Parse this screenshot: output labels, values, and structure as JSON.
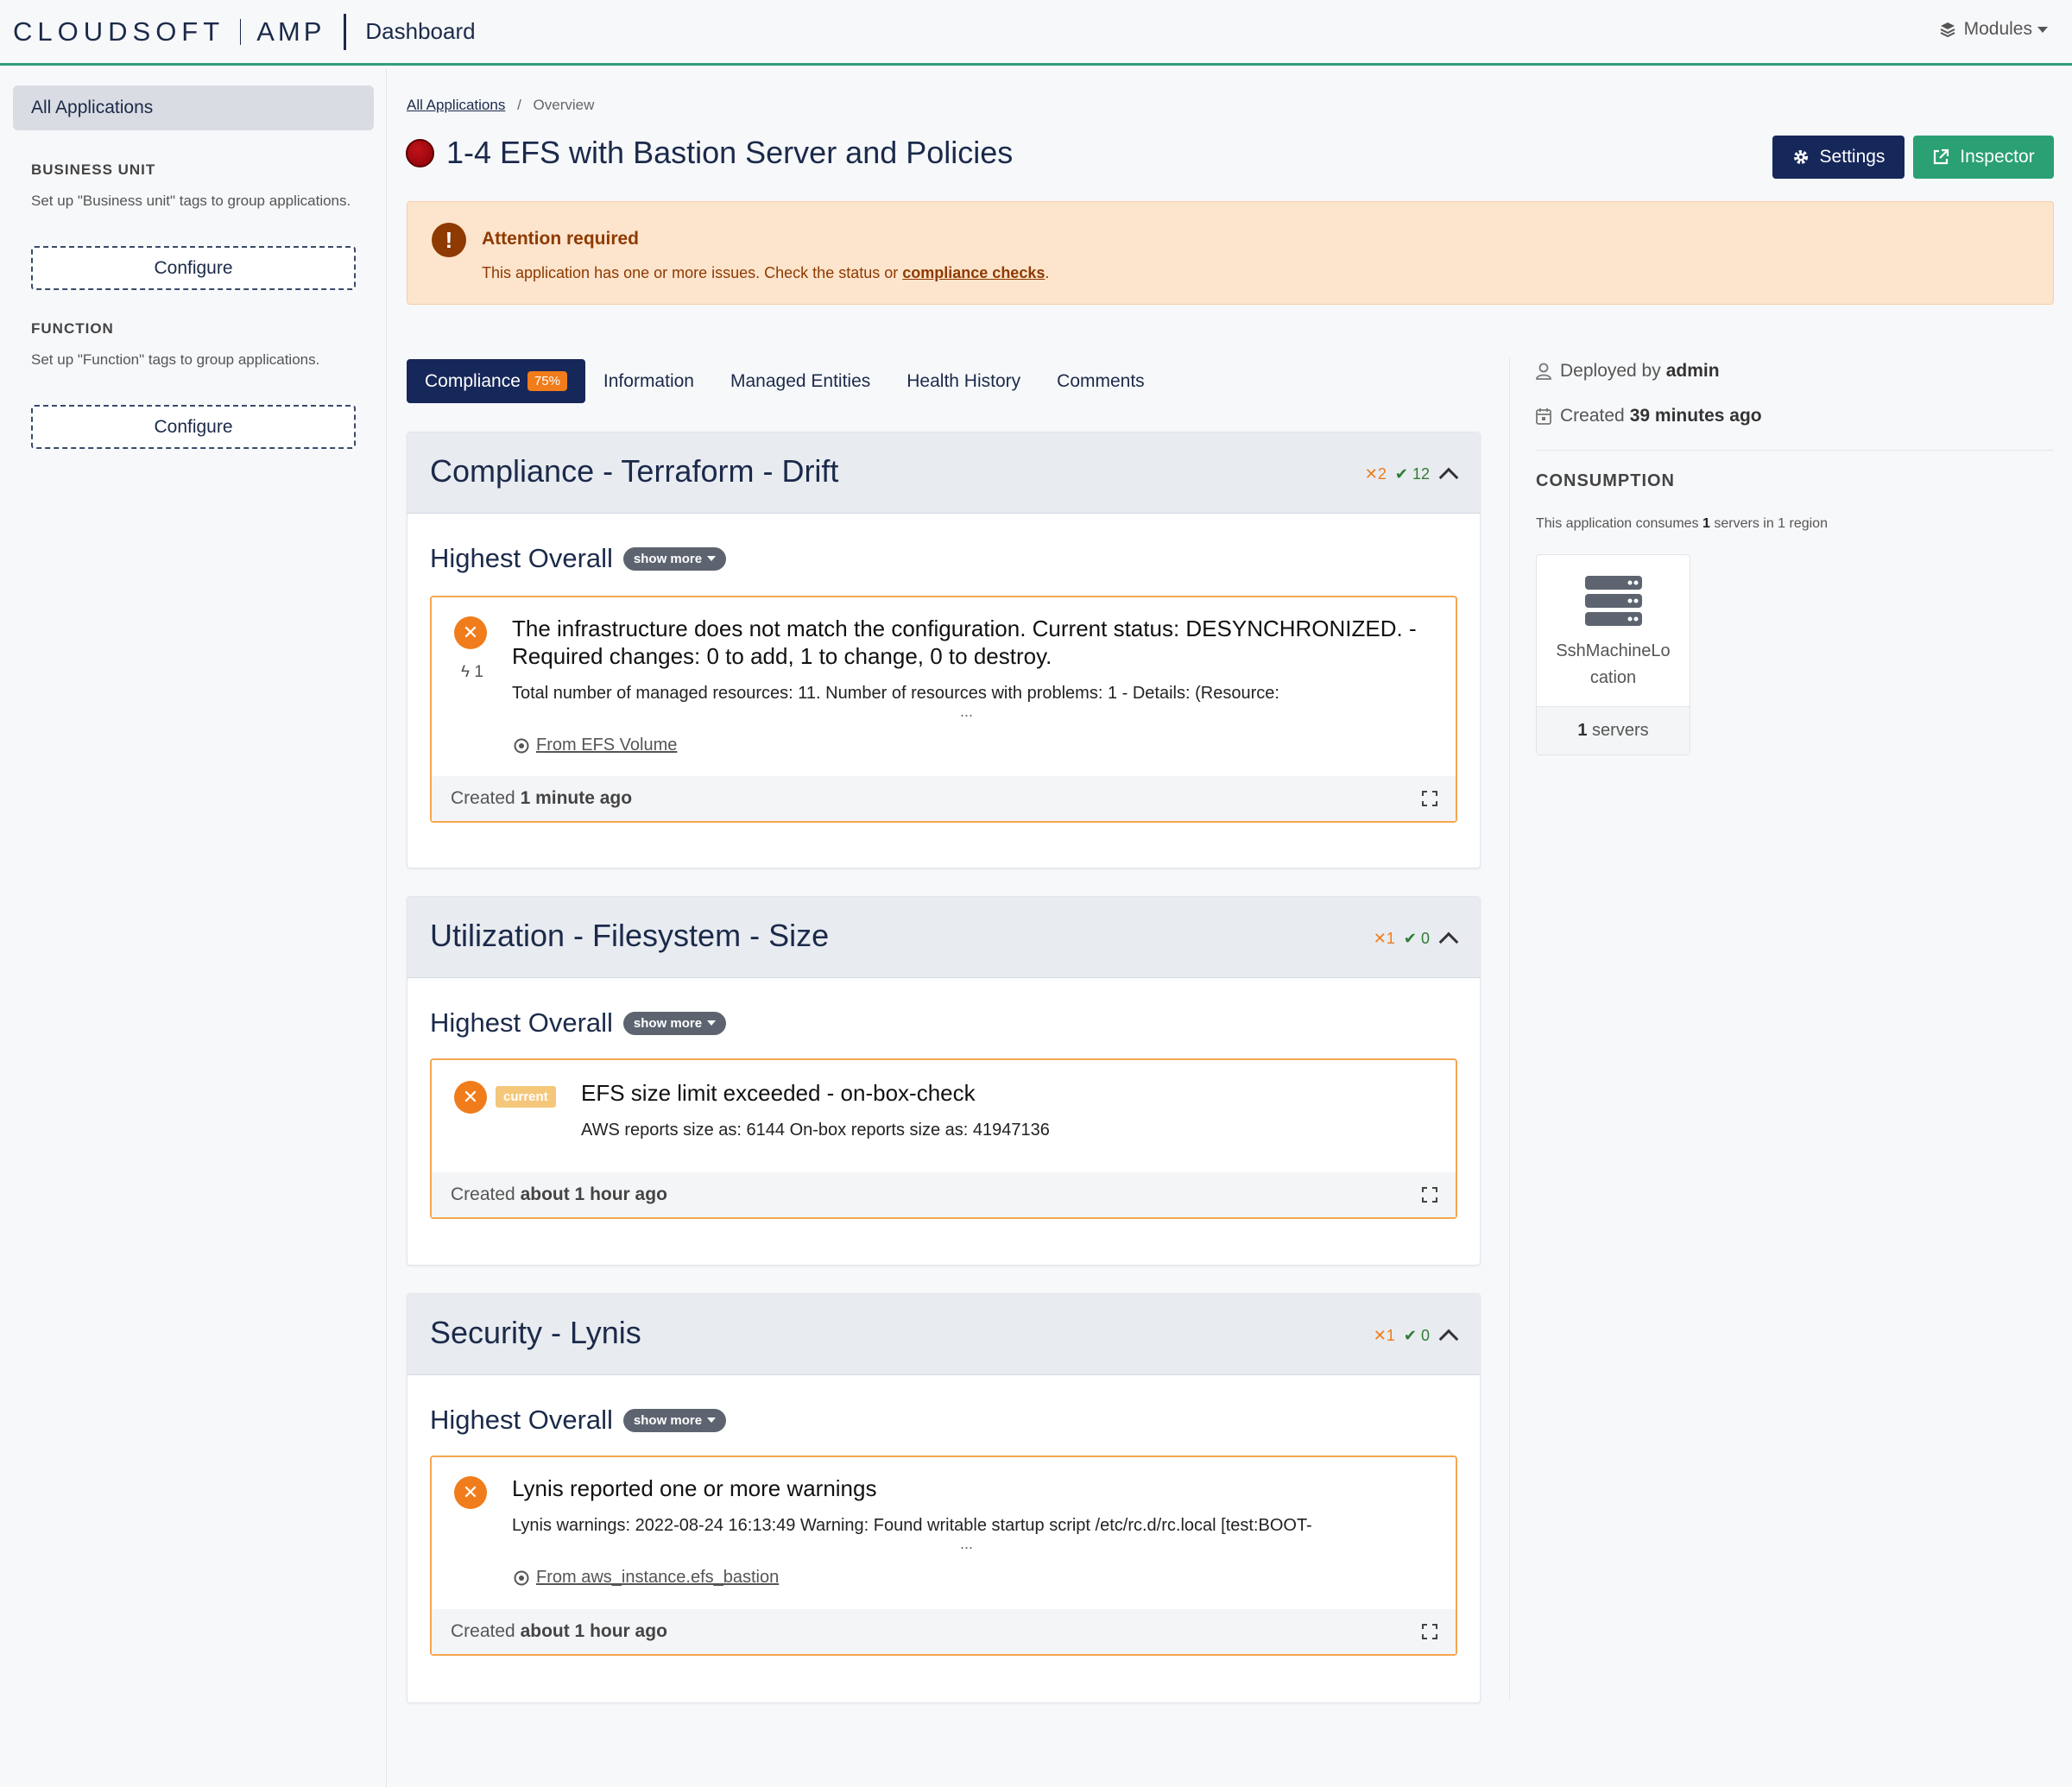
{
  "header": {
    "logo_text": "CLOUDSOFT",
    "logo_product": "AMP",
    "title": "Dashboard",
    "modules_label": "Modules"
  },
  "sidebar": {
    "all_apps": "All Applications",
    "sections": [
      {
        "heading": "BUSINESS UNIT",
        "text": "Set up \"Business unit\" tags to group applications.",
        "button": "Configure"
      },
      {
        "heading": "FUNCTION",
        "text": "Set up \"Function\" tags to group applications.",
        "button": "Configure"
      }
    ]
  },
  "breadcrumb": {
    "link": "All Applications",
    "separator": "/",
    "current": "Overview"
  },
  "app": {
    "title": "1-4 EFS with Bastion Server and Policies",
    "status_color": "#a8000a",
    "settings_label": "Settings",
    "inspector_label": "Inspector"
  },
  "alert": {
    "icon": "!",
    "title": "Attention required",
    "text": "This application has one or more issues. Check the status or",
    "link": "compliance checks",
    "suffix": "."
  },
  "tabs": [
    {
      "label": "Compliance",
      "badge": "75%"
    },
    {
      "label": "Information"
    },
    {
      "label": "Managed Entities"
    },
    {
      "label": "Health History"
    },
    {
      "label": "Comments"
    }
  ],
  "checks": [
    {
      "title": "Compliance - Terraform - Drift",
      "fail_count": "2",
      "ok_count": "12",
      "highest_label": "Highest Overall",
      "show_more": "show more",
      "issue": {
        "title": "The infrastructure does not match the configuration. Current status: DESYNCHRONIZED. - Required changes: 0 to add, 1 to change, 0 to destroy.",
        "bolt_count": "1",
        "description": "Total number of managed resources: 11. Number of resources with problems: 1 - Details: (Resource:",
        "ellipsis": "...",
        "from": "From EFS Volume",
        "created_prefix": "Created",
        "created_when": "1 minute ago"
      }
    },
    {
      "title": "Utilization - Filesystem - Size",
      "fail_count": "1",
      "ok_count": "0",
      "highest_label": "Highest Overall",
      "show_more": "show more",
      "issue": {
        "badge": "current",
        "title": "EFS size limit exceeded - on-box-check",
        "description": "AWS reports size as: 6144 On-box reports size as: 41947136",
        "created_prefix": "Created",
        "created_when": "about 1 hour ago"
      }
    },
    {
      "title": "Security - Lynis",
      "fail_count": "1",
      "ok_count": "0",
      "highest_label": "Highest Overall",
      "show_more": "show more",
      "issue": {
        "title": "Lynis reported one or more warnings",
        "description": "Lynis warnings: 2022-08-24 16:13:49 Warning: Found writable startup script /etc/rc.d/rc.local [test:BOOT-",
        "ellipsis": "...",
        "from": "From aws_instance.efs_bastion",
        "created_prefix": "Created",
        "created_when": "about 1 hour ago"
      }
    }
  ],
  "right_panel": {
    "deployed_prefix": "Deployed by",
    "deployed_by": "admin",
    "created_prefix": "Created",
    "created_when": "39 minutes ago",
    "consumption_heading": "CONSUMPTION",
    "consumption_prefix": "This application consumes",
    "consumption_count": "1",
    "consumption_suffix": "servers in 1 region",
    "server": {
      "name": "SshMachineLocation",
      "count": "1",
      "unit": "servers"
    }
  },
  "colors": {
    "accent": "#2e9e78",
    "primary": "#16275a",
    "warning": "#f07c1b",
    "ok": "#2e7d32"
  }
}
